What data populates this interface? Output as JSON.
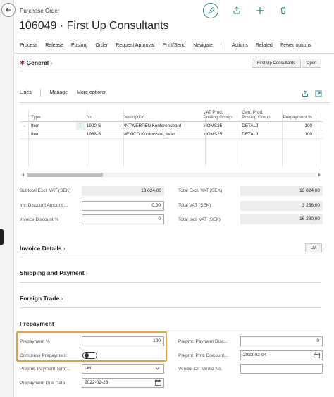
{
  "header": {
    "caption": "Purchase Order",
    "title": "106049 · First Up Consultants"
  },
  "menu": [
    "Process",
    "Release",
    "Posting",
    "Order",
    "Request Approval",
    "Print/Send",
    "Navigate",
    "Actions",
    "Related",
    "Fewer options"
  ],
  "general": {
    "title": "General",
    "vendor_button": "First Up Consultants",
    "status": "Open"
  },
  "lines": {
    "title": "Lines",
    "manage": "Manage",
    "more": "More options",
    "columns": [
      "Type",
      "No.",
      "Description",
      "VAT Prod. Posting Group",
      "Gen. Prod. Posting Group",
      "Prepayment %"
    ],
    "rows": [
      {
        "type": "Item",
        "no": "1920-S",
        "description": "ANTWERPEN Konferensbord",
        "vat": "MOMS25",
        "gen": "DETALJ",
        "prepayment": "100"
      },
      {
        "type": "Item",
        "no": "1968-S",
        "description": "MEXICO Kontorsstol, svart",
        "vat": "MOMS25",
        "gen": "DETALJ",
        "prepayment": "100"
      }
    ]
  },
  "totals": {
    "subtotal_label": "Subtotal Excl. VAT (SEK)",
    "subtotal_value": "13 024,00",
    "inv_disc_amount_label": "Inv. Discount Amount ...",
    "inv_disc_amount_value": "0,00",
    "invoice_disc_pct_label": "Invoice Discount %",
    "invoice_disc_pct_value": "0",
    "total_excl_label": "Total Excl. VAT (SEK)",
    "total_excl_value": "13 024,00",
    "total_vat_label": "Total VAT (SEK)",
    "total_vat_value": "3 256,00",
    "total_incl_label": "Total Incl. VAT (SEK)",
    "total_incl_value": "16 280,00"
  },
  "invoice_details": {
    "title": "Invoice Details",
    "badge": "LM"
  },
  "shipping": {
    "title": "Shipping and Payment"
  },
  "foreign": {
    "title": "Foreign Trade"
  },
  "prepayment": {
    "title": "Prepayment",
    "pct_label": "Prepayment %",
    "pct_value": "100",
    "compress_label": "Compress Prepayment",
    "terms_label": "Prepmt. Payment Term...",
    "terms_value": "LM",
    "due_label": "Prepayment Due Date",
    "due_value": "2022-02-28",
    "disc_pct_label": "Prepmt. Payment Disc...",
    "disc_pct_value": "0",
    "disc_date_label": "Prepmt. Pmt. Discount...",
    "disc_date_value": "2022-02-04",
    "vendor_memo_label": "Vendor Cr. Memo No.",
    "vendor_memo_value": ""
  },
  "colors": {
    "accent": "#29827f",
    "highlight": "#e8a33c",
    "required": "#c8102e"
  }
}
